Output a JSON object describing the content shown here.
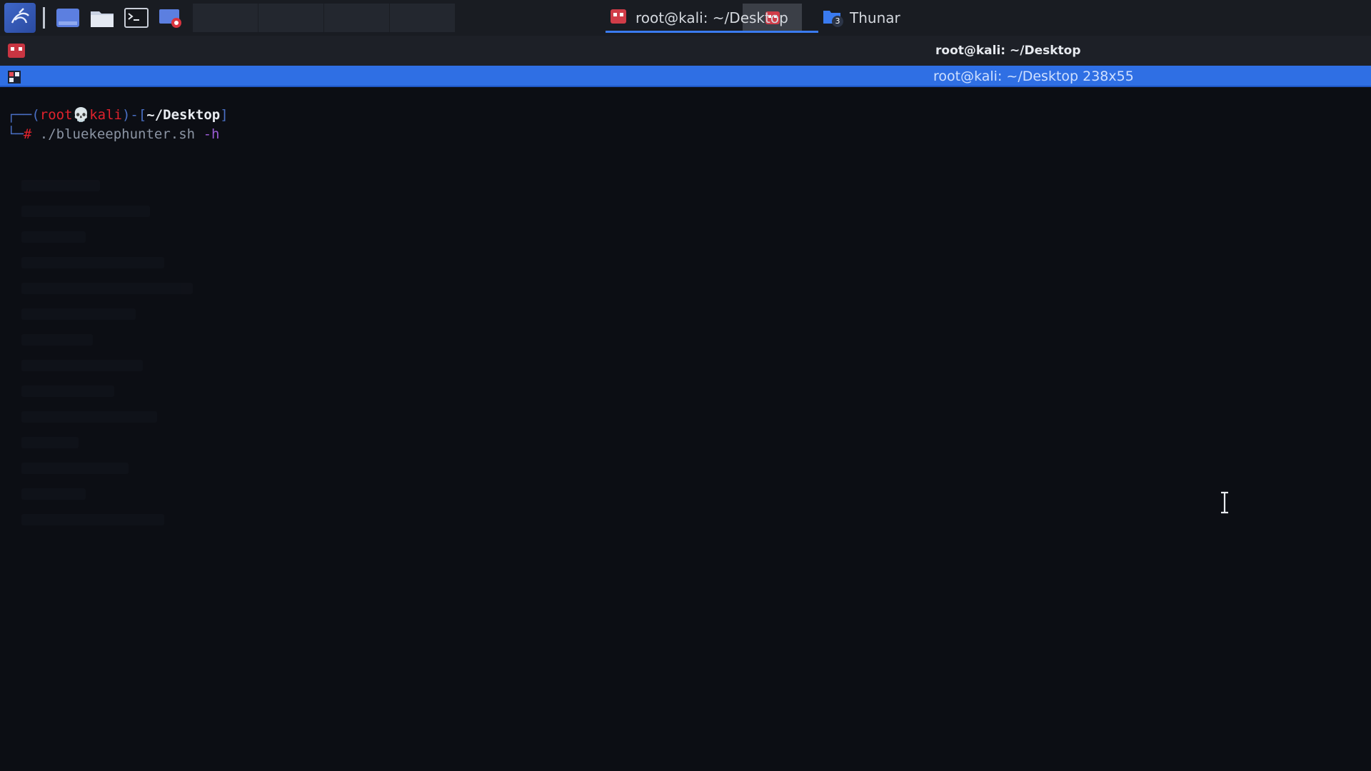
{
  "panel": {
    "launchers": [
      {
        "name": "kali-menu-icon"
      },
      {
        "name": "show-desktop-icon"
      },
      {
        "name": "file-manager-icon"
      },
      {
        "name": "terminal-icon"
      },
      {
        "name": "screen-recorder-icon"
      }
    ],
    "tasks": [
      {
        "label": "root@kali: ~/Desktop",
        "icon": "terminal-window-icon",
        "active": true
      },
      {
        "label": "Thunar",
        "icon": "folder-icon",
        "badge": "3",
        "active": false
      }
    ]
  },
  "terminal": {
    "window_title": "root@kali: ~/Desktop",
    "tab_title": "root@kali: ~/Desktop 238x55",
    "prompt": {
      "frame_open": "┌──(",
      "user": "root",
      "skull": "💀",
      "host": "kali",
      "frame_mid": ")-[",
      "path": "~/Desktop",
      "frame_close": "]",
      "frame_bottom": "└─",
      "symbol": "#",
      "command": " ./bluekeephunter.sh",
      "flag": " -h"
    }
  },
  "colors": {
    "accent": "#2f6fe4",
    "kali_red": "#e0222d",
    "frame_blue": "#4a6fc4",
    "terminal_bg": "#0c0e14"
  }
}
